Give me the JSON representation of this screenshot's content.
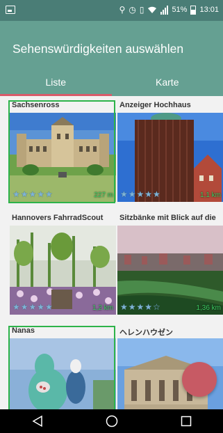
{
  "status_bar": {
    "battery": "51%",
    "time": "13:01",
    "icons": [
      "image-icon",
      "location-icon",
      "alarm-icon",
      "vibrate-icon",
      "wifi-icon",
      "signal-icon",
      "battery-icon"
    ]
  },
  "app_bar": {
    "title": "Sehenswürdigkeiten auswählen",
    "tabs": [
      {
        "label": "Liste",
        "active": true
      },
      {
        "label": "Karte",
        "active": false
      }
    ]
  },
  "cards": [
    {
      "title": "Sachsenross",
      "distance": "227 m",
      "rating": 5,
      "selected": true
    },
    {
      "title": "Anzeiger Hochhaus",
      "distance": "1,1 km",
      "rating": 5,
      "selected": false
    },
    {
      "title": "Hannovers FahrradScout",
      "distance": "1,2 km",
      "rating": 5,
      "selected": false
    },
    {
      "title": "Sitzbänke mit Blick auf die",
      "distance": "1,36 km",
      "rating": 4,
      "selected": false
    },
    {
      "title": "Nanas",
      "distance": "",
      "rating": 0,
      "selected": true
    },
    {
      "title": "ヘレンハウゼン",
      "distance": "",
      "rating": 0,
      "selected": false
    }
  ],
  "colors": {
    "app_bar": "#65a092",
    "status_bar": "#4a7d76",
    "tab_indicator": "#d85a6a",
    "selected_border": "#2db34a",
    "fab": "#c75a64"
  },
  "nav_bar": {
    "buttons": [
      "back-icon",
      "home-icon",
      "recents-icon"
    ]
  }
}
